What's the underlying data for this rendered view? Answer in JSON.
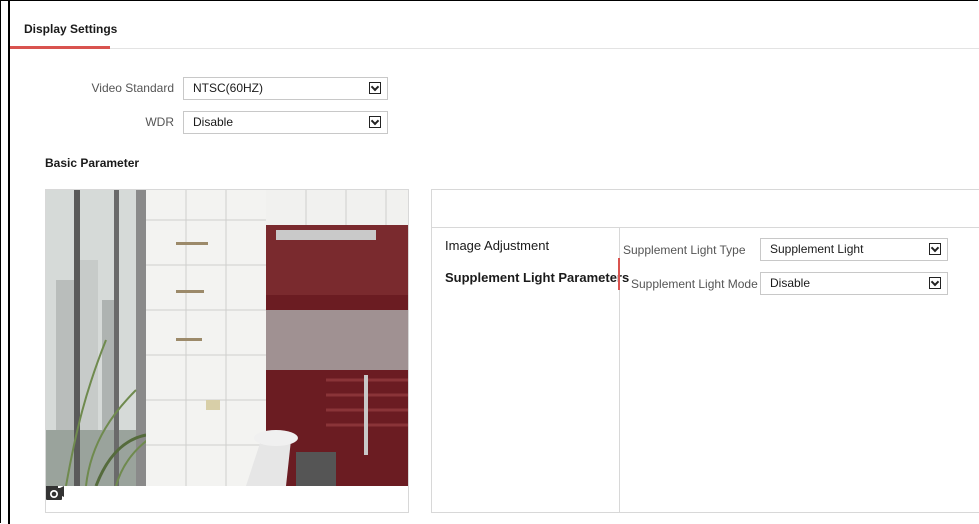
{
  "tabs": {
    "display_settings": "Display Settings"
  },
  "video_standard": {
    "label": "Video Standard",
    "value": "NTSC(60HZ)"
  },
  "wdr": {
    "label": "WDR",
    "value": "Disable"
  },
  "basic_parameter": {
    "title": "Basic Parameter"
  },
  "preview": {
    "icons": [
      "video-camera-icon",
      "snapshot-camera-icon"
    ]
  },
  "side_menu": {
    "items": [
      {
        "label": "Image Adjustment",
        "active": false
      },
      {
        "label": "Supplement Light Parameters",
        "active": true
      }
    ]
  },
  "supplement_light": {
    "type_label": "Supplement Light Type",
    "type_value": "Supplement Light",
    "mode_label": "Supplement Light Mode",
    "mode_value": "Disable"
  },
  "colors": {
    "accent": "#d9534f",
    "border": "#d8d8d8"
  }
}
